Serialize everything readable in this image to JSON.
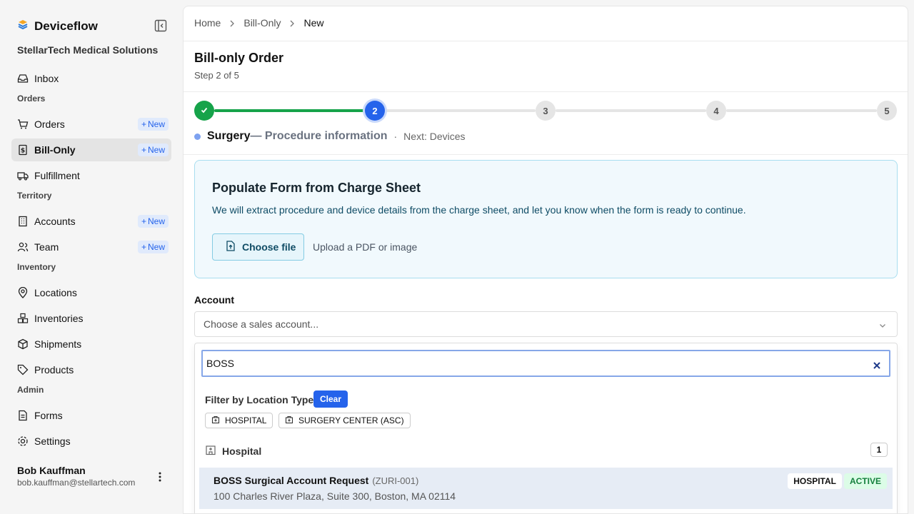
{
  "app": {
    "name": "Deviceflow",
    "org": "StellarTech Medical Solutions"
  },
  "sidebar": {
    "inbox": "Inbox",
    "sections": {
      "orders": "Orders",
      "territory": "Territory",
      "inventory": "Inventory",
      "admin": "Admin"
    },
    "items": {
      "orders": "Orders",
      "bill_only": "Bill-Only",
      "fulfillment": "Fulfillment",
      "accounts": "Accounts",
      "team": "Team",
      "locations": "Locations",
      "inventories": "Inventories",
      "shipments": "Shipments",
      "products": "Products",
      "forms": "Forms",
      "settings": "Settings"
    },
    "new_label": "New"
  },
  "user": {
    "name": "Bob Kauffman",
    "email": "bob.kauffman@stellartech.com"
  },
  "breadcrumb": [
    "Home",
    "Bill-Only",
    "New"
  ],
  "page": {
    "title": "Bill-only Order",
    "step": "Step 2 of 5"
  },
  "stepper": {
    "steps": [
      "2",
      "3",
      "4",
      "5"
    ],
    "current_name": "Surgery",
    "current_desc": "— Procedure information",
    "separator": "·",
    "next": "Next: Devices"
  },
  "charge_sheet": {
    "title": "Populate Form from Charge Sheet",
    "description": "We will extract procedure and device details from the charge sheet, and let you know when the form is ready to continue.",
    "button": "Choose file",
    "hint": "Upload a PDF or image"
  },
  "account": {
    "label": "Account",
    "placeholder": "Choose a sales account...",
    "search_value": "BOSS",
    "filter_label": "Filter by Location Type",
    "clear_label": "Clear",
    "chips": [
      "HOSPITAL",
      "SURGERY CENTER (ASC)"
    ],
    "group": {
      "name": "Hospital",
      "count": "1"
    },
    "result": {
      "name": "BOSS Surgical Account Request",
      "code": "(ZURI-001)",
      "address": "100 Charles River Plaza, Suite 300, Boston, MA 02114",
      "type": "HOSPITAL",
      "status": "ACTIVE"
    }
  },
  "colors": {
    "accent": "#2563eb",
    "success": "#16a34a"
  }
}
